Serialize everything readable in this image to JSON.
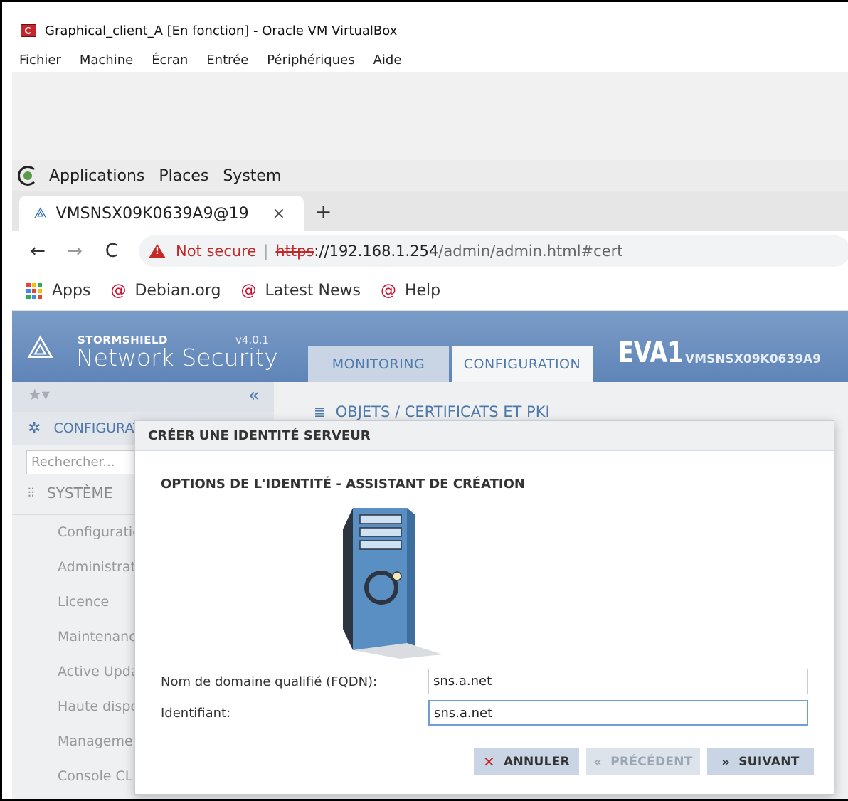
{
  "vbox": {
    "title": "Graphical_client_A [En fonction] - Oracle VM VirtualBox",
    "menu": [
      "Fichier",
      "Machine",
      "Écran",
      "Entrée",
      "Périphériques",
      "Aide"
    ]
  },
  "gnome": {
    "menu": [
      "Applications",
      "Places",
      "System"
    ]
  },
  "browser": {
    "tab_title": "VMSNSX09K0639A9@19",
    "tab_close": "×",
    "new_tab": "+",
    "security_label": "Not secure",
    "url_protocol": "https",
    "url_host": "://192.168.1.254",
    "url_path": "/admin/admin.html#cert",
    "bookmarks": [
      "Apps",
      "Debian.org",
      "Latest News",
      "Help"
    ]
  },
  "app": {
    "brand_small": "STORMSHIELD",
    "brand_version": "v4.0.1",
    "brand_name": "Network Security",
    "tabs": [
      "MONITORING",
      "CONFIGURATION"
    ],
    "firewall_name": "EVA1",
    "firewall_serial": "VMSNSX09K0639A9",
    "accent_color": "#4f79aa"
  },
  "sidebar": {
    "section": "CONFIGURAT",
    "search_placeholder": "Rechercher...",
    "system_label": "SYSTÈME",
    "items": [
      "Configuration",
      "Administrateu",
      "Licence",
      "Maintenance",
      "Active Update",
      "Haute disponi",
      "Management",
      "Console CLI"
    ]
  },
  "main": {
    "breadcrumb": "OBJETS / CERTIFICATS ET PKI"
  },
  "modal": {
    "title": "CRÉER UNE IDENTITÉ SERVEUR",
    "subtitle": "OPTIONS DE L'IDENTITÉ - ASSISTANT DE CRÉATION",
    "fqdn_label": "Nom de domaine qualifié (FQDN):",
    "fqdn_value": "sns.a.net",
    "id_label": "Identifiant:",
    "id_value": "sns.a.net",
    "cancel_label": "ANNULER",
    "prev_label": "PRÉCÉDENT",
    "next_label": "SUIVANT"
  }
}
